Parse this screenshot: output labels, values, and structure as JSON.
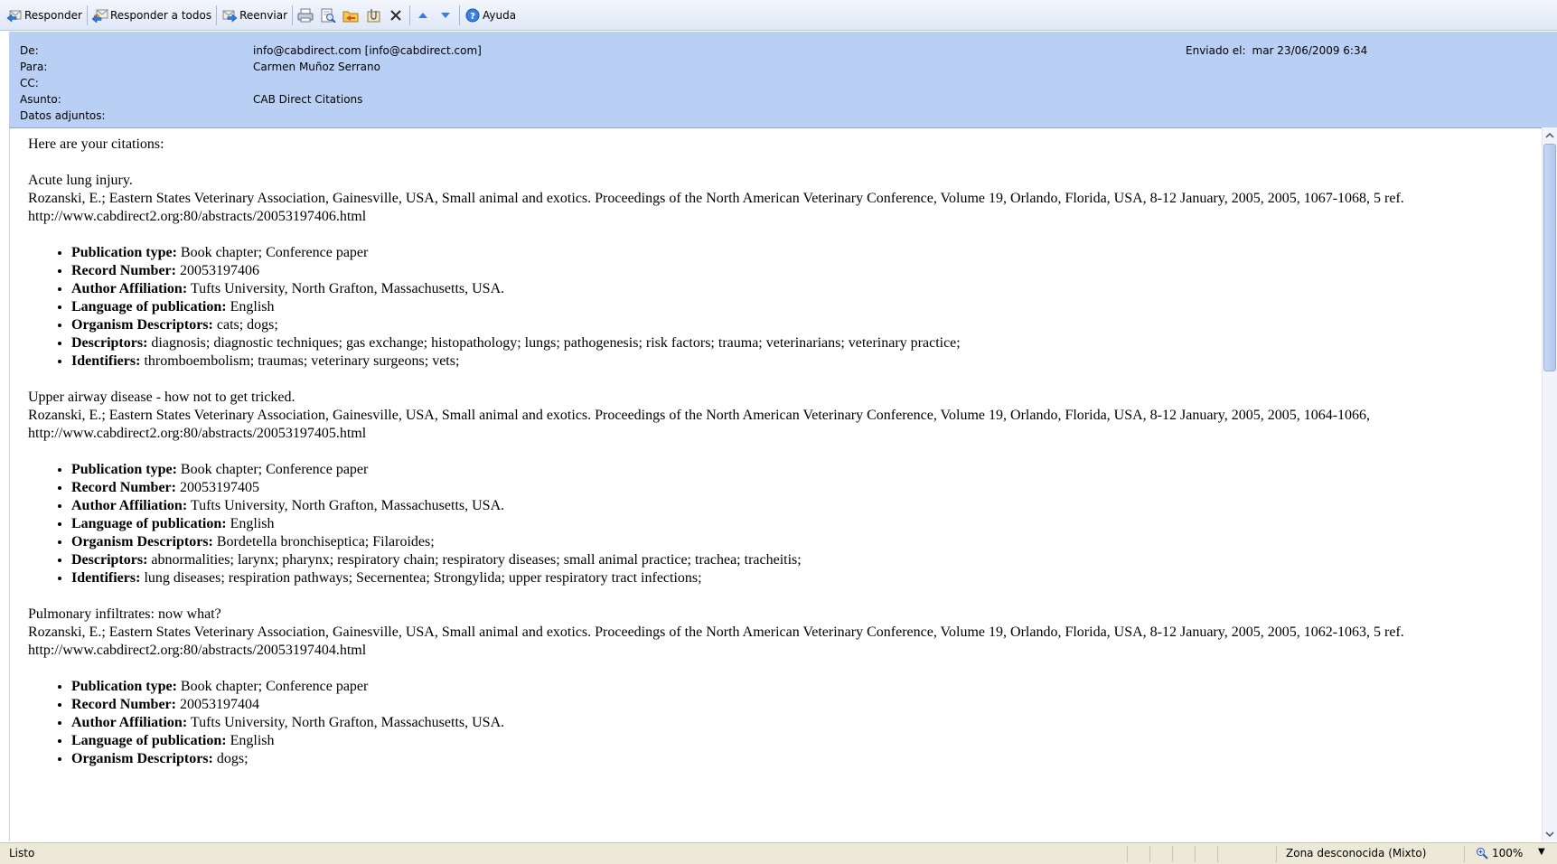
{
  "toolbar": {
    "reply": "Responder",
    "reply_all": "Responder a todos",
    "forward": "Reenviar",
    "help": "Ayuda",
    "icons": [
      "reply-icon",
      "reply-all-icon",
      "forward-icon",
      "print-icon",
      "print-preview-icon",
      "move-to-folder-icon",
      "attach-icon",
      "delete-icon",
      "previous-icon",
      "next-icon",
      "help-icon"
    ]
  },
  "headers": {
    "from_label": "De:",
    "from_value": "info@cabdirect.com [info@cabdirect.com]",
    "to_label": "Para:",
    "to_value": "Carmen Muñoz Serrano",
    "cc_label": "CC:",
    "cc_value": "",
    "subject_label": "Asunto:",
    "subject_value": "CAB Direct Citations",
    "attachments_label": "Datos adjuntos:",
    "sent_label": "Enviado el:",
    "sent_value": "mar 23/06/2009 6:34"
  },
  "message": {
    "intro": "Here are your citations:",
    "citations": [
      {
        "title": "Acute lung injury.",
        "source": "Rozanski, E.; Eastern States Veterinary Association, Gainesville, USA, Small animal and exotics. Proceedings of the North American Veterinary Conference, Volume 19, Orlando, Florida, USA, 8-12 January, 2005, 2005, 1067-1068, 5 ref.",
        "url": "http://www.cabdirect2.org:80/abstracts/20053197406.html",
        "fields": [
          {
            "label": "Publication type:",
            "value": "Book chapter; Conference paper"
          },
          {
            "label": "Record Number:",
            "value": "20053197406"
          },
          {
            "label": "Author Affiliation:",
            "value": "Tufts University, North Grafton, Massachusetts, USA."
          },
          {
            "label": "Language of publication:",
            "value": "English"
          },
          {
            "label": "Organism Descriptors:",
            "value": "cats; dogs;"
          },
          {
            "label": "Descriptors:",
            "value": "diagnosis; diagnostic techniques; gas exchange; histopathology; lungs; pathogenesis; risk factors; trauma; veterinarians; veterinary practice;"
          },
          {
            "label": "Identifiers:",
            "value": "thromboembolism; traumas; veterinary surgeons; vets;"
          }
        ]
      },
      {
        "title": "Upper airway disease - how not to get tricked.",
        "source": "Rozanski, E.; Eastern States Veterinary Association, Gainesville, USA, Small animal and exotics. Proceedings of the North American Veterinary Conference, Volume 19, Orlando, Florida, USA, 8-12 January, 2005, 2005, 1064-1066,",
        "url": "http://www.cabdirect2.org:80/abstracts/20053197405.html",
        "fields": [
          {
            "label": "Publication type:",
            "value": "Book chapter; Conference paper"
          },
          {
            "label": "Record Number:",
            "value": "20053197405"
          },
          {
            "label": "Author Affiliation:",
            "value": "Tufts University, North Grafton, Massachusetts, USA."
          },
          {
            "label": "Language of publication:",
            "value": "English"
          },
          {
            "label": "Organism Descriptors:",
            "value": "Bordetella bronchiseptica; Filaroides;"
          },
          {
            "label": "Descriptors:",
            "value": "abnormalities; larynx; pharynx; respiratory chain; respiratory diseases; small animal practice; trachea; tracheitis;"
          },
          {
            "label": "Identifiers:",
            "value": "lung diseases; respiration pathways; Secernentea; Strongylida; upper respiratory tract infections;"
          }
        ]
      },
      {
        "title": "Pulmonary infiltrates: now what?",
        "source": "Rozanski, E.; Eastern States Veterinary Association, Gainesville, USA, Small animal and exotics. Proceedings of the North American Veterinary Conference, Volume 19, Orlando, Florida, USA, 8-12 January, 2005, 2005, 1062-1063, 5 ref.",
        "url": "http://www.cabdirect2.org:80/abstracts/20053197404.html",
        "fields": [
          {
            "label": "Publication type:",
            "value": "Book chapter; Conference paper"
          },
          {
            "label": "Record Number:",
            "value": "20053197404"
          },
          {
            "label": "Author Affiliation:",
            "value": "Tufts University, North Grafton, Massachusetts, USA."
          },
          {
            "label": "Language of publication:",
            "value": "English"
          },
          {
            "label": "Organism Descriptors:",
            "value": "dogs;"
          }
        ]
      }
    ]
  },
  "statusbar": {
    "status": "Listo",
    "zone": "Zona desconocida (Mixto)",
    "zoom": "100%"
  },
  "colors": {
    "header_bg": "#b9d0f4",
    "toolbar_bg": "#dfe8f7",
    "statusbar_bg": "#ece9d8",
    "scroll_thumb": "#b3c7ec"
  }
}
